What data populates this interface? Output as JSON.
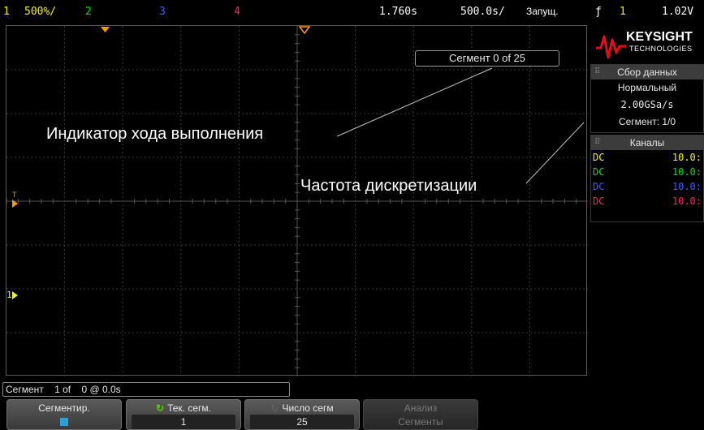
{
  "topbar": {
    "ch1_num": "1",
    "ch1_scale": "500%/",
    "ch2_num": "2",
    "ch3_num": "3",
    "ch4_num": "4",
    "time_delay": "1.760s",
    "time_scale": "500.0s/",
    "run_state": "Запущ.",
    "trig_icon": "ƒ",
    "trig_src": "1",
    "trig_level": "1.02V"
  },
  "screen": {
    "segment_indicator": "Сегмент 0 of 25"
  },
  "annotations": {
    "progress": "Индикатор хода выполнения",
    "sample_rate": "Частота дискретизации"
  },
  "markers": {
    "trigger_marker": "T",
    "ch1_ground_marker": "1"
  },
  "logo": {
    "brand": "KEYSIGHT",
    "sub": "TECHNOLOGIES"
  },
  "acquisition": {
    "title": "Сбор данных",
    "mode": "Нормальный",
    "rate": "2.00GSa/s",
    "segment": "Сегмент: 1/0"
  },
  "channels": {
    "title": "Каналы",
    "rows": [
      {
        "coupling": "DC",
        "value": "10.0:",
        "color": "#f5f500"
      },
      {
        "coupling": "DC",
        "value": "10.0:",
        "color": "#00e000"
      },
      {
        "coupling": "DC",
        "value": "10.0:",
        "color": "#3a5cff"
      },
      {
        "coupling": "DC",
        "value": "10.0:",
        "color": "#ff1f6a"
      }
    ]
  },
  "segment_bar": {
    "text": "Сегмент    1 of    0 @ 0.0s"
  },
  "softkeys": {
    "segmented_label": "Сегментир.",
    "current_label": "Тек. сегм.",
    "current_value": "1",
    "count_label": "Число сегм",
    "count_value": "25",
    "analyze_label": "Анализ",
    "analyze_value": "Сегменты"
  },
  "colors": {
    "ch1": "#f5f500",
    "ch2": "#00e000",
    "ch3": "#3a5cff",
    "ch4": "#ff1f6a",
    "marker": "#ff9900"
  }
}
